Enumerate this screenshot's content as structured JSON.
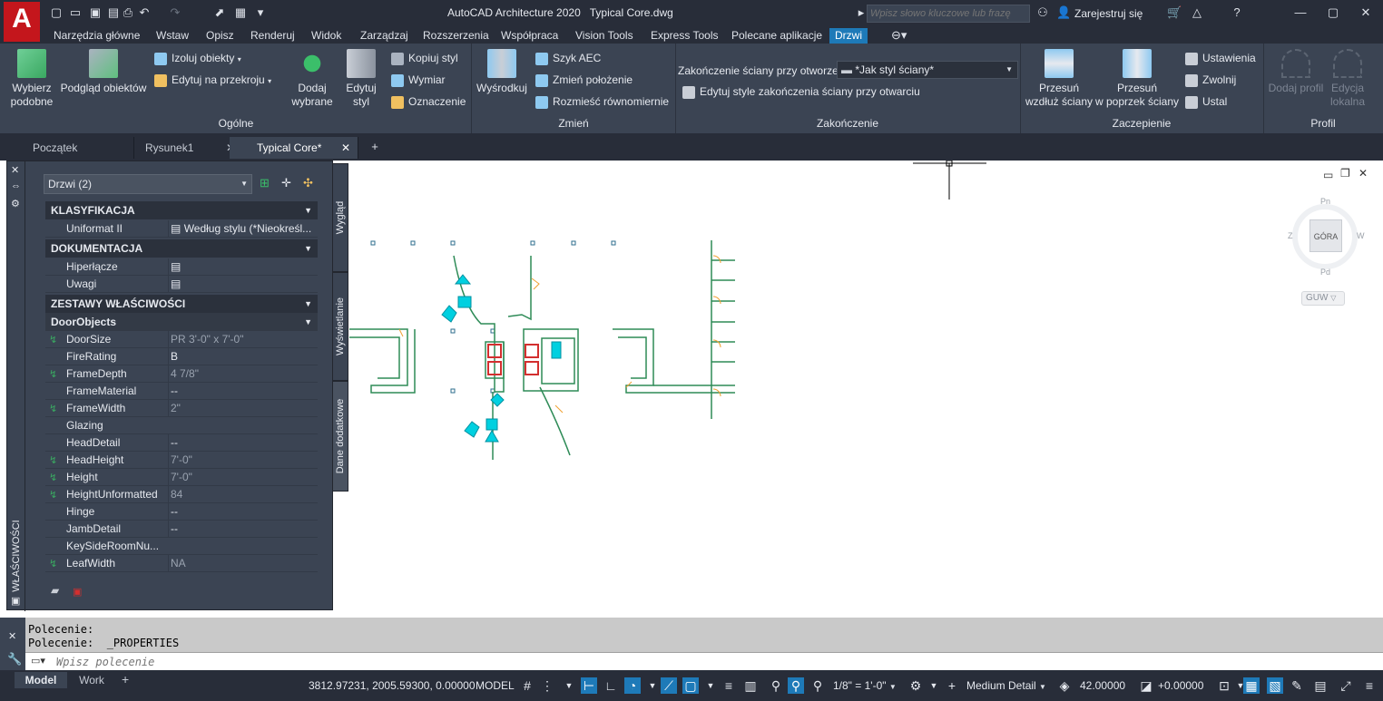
{
  "app": {
    "title": "AutoCAD Architecture 2020",
    "document": "Typical Core.dwg",
    "logo_letter": "A",
    "search_placeholder": "Wpisz słowo kluczowe lub frazę",
    "signin_label": "Zarejestruj się"
  },
  "ribbon_tabs": [
    "Narzędzia główne",
    "Wstaw",
    "Opisz",
    "Renderuj",
    "Widok",
    "Zarządzaj",
    "Rozszerzenia",
    "Współpraca",
    "Vision Tools",
    "Express Tools",
    "Polecane aplikacje",
    "Drzwi"
  ],
  "ribbon": {
    "general": {
      "title": "Ogólne",
      "select_similar": "Wybierz\npodobne",
      "object_viewer": "Podgląd obiektów",
      "isolate": "Izoluj obiekty",
      "edit_in_section": "Edytuj na przekroju",
      "add_selected": "Dodaj\nwybrane",
      "edit_style": "Edytuj\nstyl",
      "copy_style": "Kopiuj styl",
      "dimension": "Wymiar",
      "tag": "Oznaczenie"
    },
    "modify": {
      "title": "Zmień",
      "center": "Wyśrodkuj",
      "aec_dim": "Szyk AEC",
      "reposition": "Zmień położenie",
      "space_evenly": "Rozmieść równomiernie"
    },
    "endcaps": {
      "title": "Zakończenie",
      "label": "Zakończenie ściany przy otworze",
      "value": "*Jak styl ściany*",
      "edit_label": "Edytuj style zakończenia ściany przy otwarciu"
    },
    "anchor": {
      "title": "Zaczepienie",
      "along_wall": "Przesuń\nwzdłuż ściany",
      "across_wall": "Przesuń\nw poprzek ściany",
      "settings": "Ustawienia",
      "release": "Zwolnij",
      "set": "Ustal"
    },
    "profile": {
      "title": "Profil",
      "add_profile": "Dodaj profil",
      "edit_in_place": "Edycja\nlokalna"
    }
  },
  "doc_tabs": [
    "Początek",
    "Rysunek1",
    "Typical Core*"
  ],
  "properties": {
    "side_title": "WŁAŚCIWOŚCI",
    "selection": "Drzwi (2)",
    "vtabs": [
      "Wygląd",
      "Wyświetlanie",
      "Dane dodatkowe"
    ],
    "sections": [
      {
        "title": "KLASYFIKACJA",
        "rows": [
          {
            "k": "Uniformat II",
            "v": "Według stylu (*Nieokreśl..."
          }
        ]
      },
      {
        "title": "DOKUMENTACJA",
        "rows": [
          {
            "k": "Hiperłącze",
            "v": ""
          },
          {
            "k": "Uwagi",
            "v": ""
          }
        ]
      },
      {
        "title": "ZESTAWY WŁAŚCIWOŚCI",
        "rows": []
      },
      {
        "title": "DoorObjects",
        "rows": [
          {
            "k": "DoorSize",
            "v": "PR 3'-0\" x 7'-0\"",
            "link": true
          },
          {
            "k": "FireRating",
            "v": "B",
            "link": false
          },
          {
            "k": "FrameDepth",
            "v": "4 7/8\"",
            "link": true
          },
          {
            "k": "FrameMaterial",
            "v": "--",
            "link": false
          },
          {
            "k": "FrameWidth",
            "v": "2\"",
            "link": true
          },
          {
            "k": "Glazing",
            "v": "",
            "link": false
          },
          {
            "k": "HeadDetail",
            "v": "--",
            "link": false
          },
          {
            "k": "HeadHeight",
            "v": "7'-0\"",
            "link": true
          },
          {
            "k": "Height",
            "v": "7'-0\"",
            "link": true
          },
          {
            "k": "HeightUnformatted",
            "v": "84",
            "link": true
          },
          {
            "k": "Hinge",
            "v": "--",
            "link": false
          },
          {
            "k": "JambDetail",
            "v": "--",
            "link": false
          },
          {
            "k": "KeySideRoomNu...",
            "v": "",
            "link": false
          },
          {
            "k": "LeafWidth",
            "v": "NA",
            "link": true
          }
        ]
      }
    ]
  },
  "viewcube": {
    "top": "GÓRA",
    "n": "Pn",
    "s": "Pd",
    "w": "Z",
    "e": "W",
    "wcs": "GUW"
  },
  "command": {
    "line1": "Polecenie:",
    "line2": "Polecenie:  _PROPERTIES",
    "placeholder": "Wpisz polecenie"
  },
  "status": {
    "model_tab": "Model",
    "work_tab": "Work",
    "coords": "3812.97231, 2005.59300, 0.00000",
    "space": "MODEL",
    "scale": "1/8\" = 1'-0\"",
    "detail": "Medium Detail",
    "elevation": "42.00000",
    "offset": "+0.00000"
  },
  "colors": {
    "accent": "#1e7ab8",
    "wall": "#2e8b57",
    "door_red": "#d32f2f",
    "door_cyan": "#00d0e0",
    "orange": "#f0a030"
  }
}
